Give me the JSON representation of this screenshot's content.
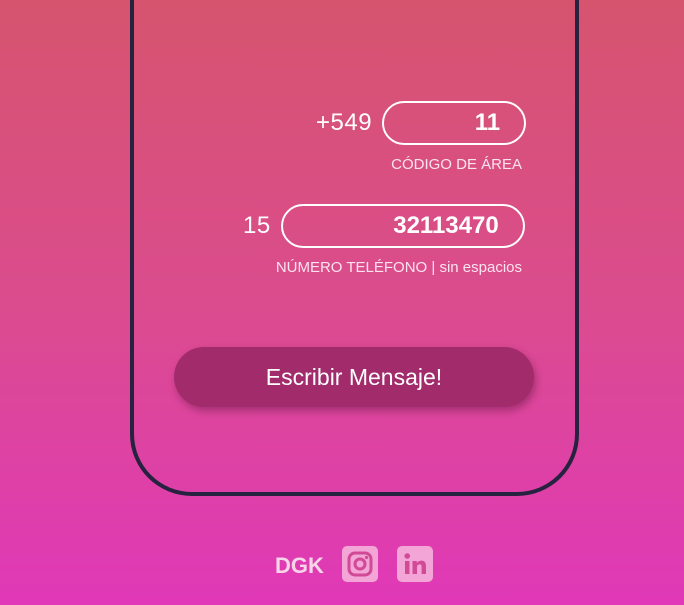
{
  "area": {
    "prefix": "+549",
    "value": "11",
    "caption": "CÓDIGO DE ÁREA"
  },
  "phone": {
    "prefix": "15",
    "value": "32113470",
    "caption": "NÚMERO TELÉFONO | sin espacios"
  },
  "cta": {
    "label": "Escribir Mensaje!"
  },
  "footer": {
    "brand": "DGK",
    "icons": [
      "instagram-icon",
      "linkedin-icon"
    ]
  },
  "colors": {
    "gradient_top": "#d6546e",
    "gradient_bottom": "#e038b8",
    "phone_frame": "#26223f",
    "button": "#a12b6b",
    "icon_bg": "#f2a5d6"
  }
}
